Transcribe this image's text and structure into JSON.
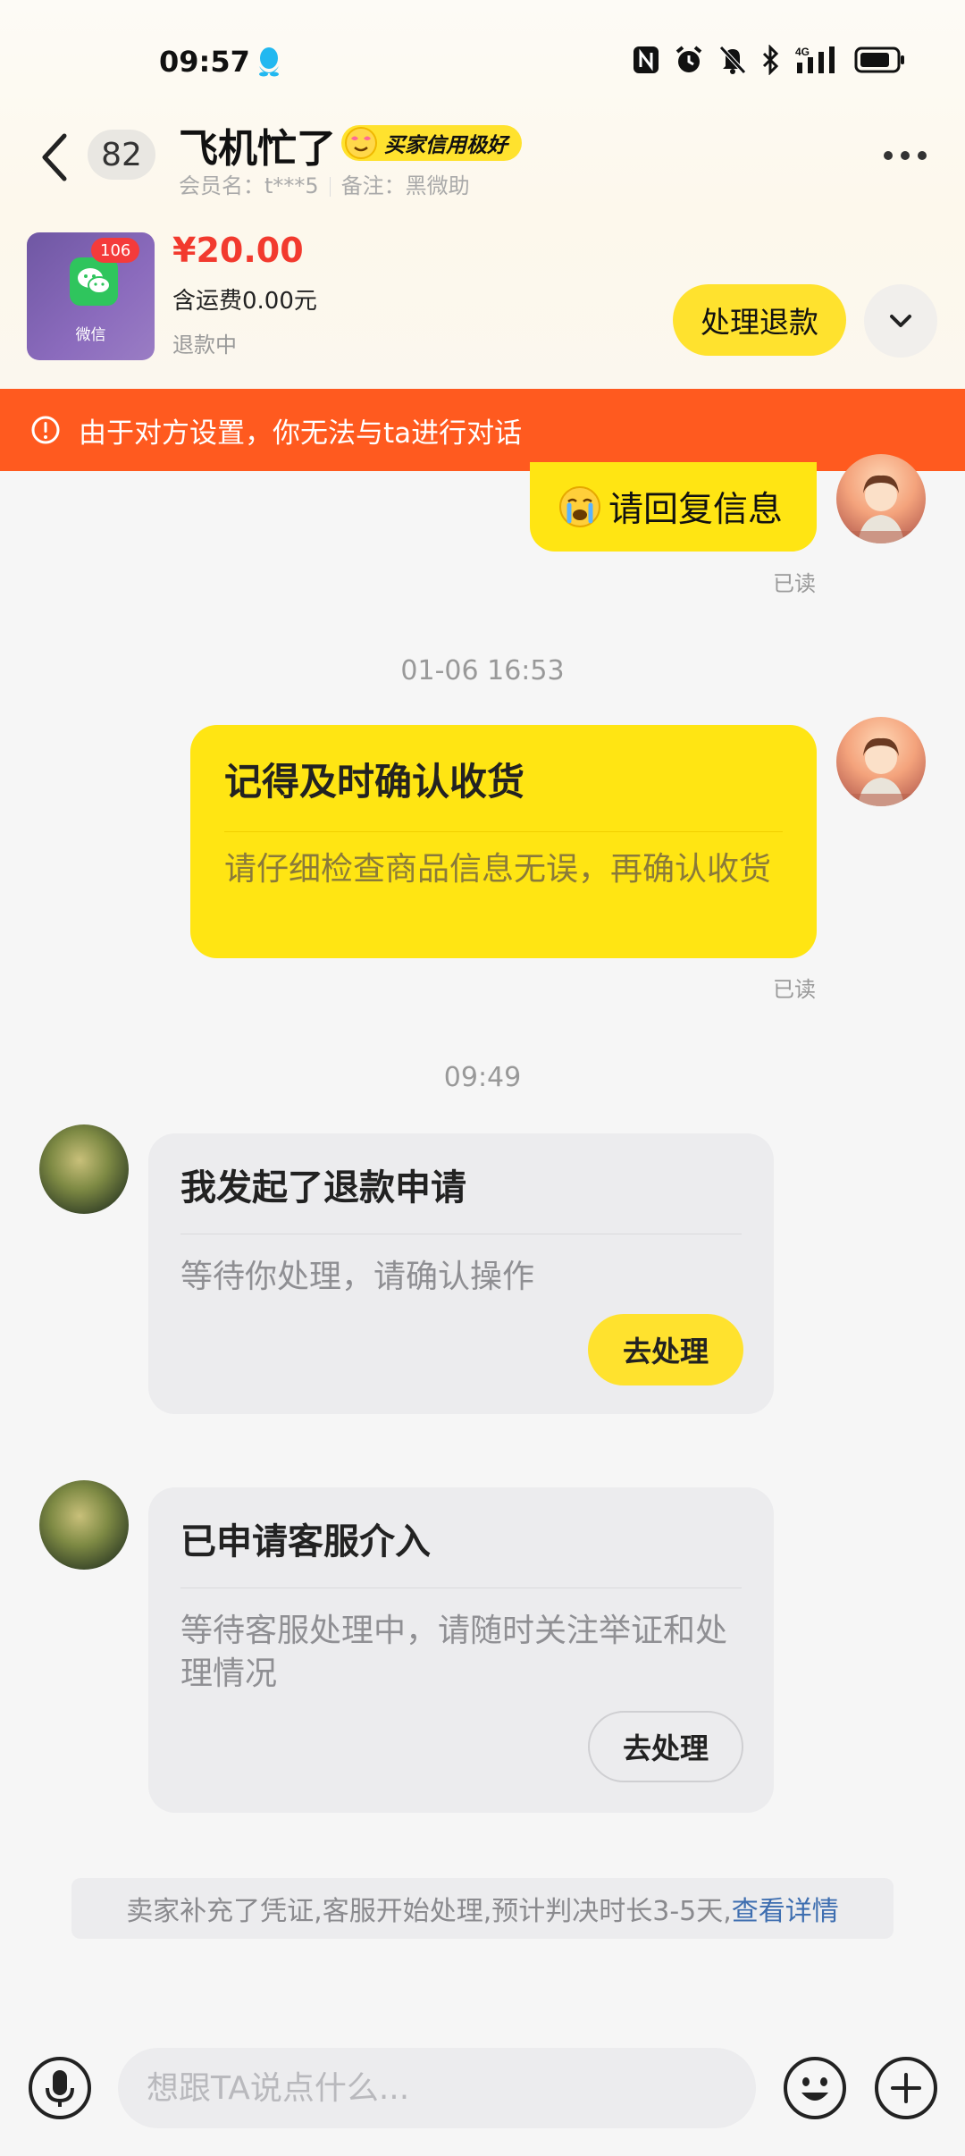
{
  "status_bar": {
    "time": "09:57",
    "network": "4G",
    "icons": [
      "qq-icon",
      "nfc-icon",
      "alarm-icon",
      "mute-icon",
      "bluetooth-icon",
      "signal-icon",
      "battery-icon"
    ]
  },
  "header": {
    "unread_count": "82",
    "title": "飞机忙了",
    "credit_badge": "买家信用极好",
    "member_label": "会员名：t***5",
    "note_label": "备注：黑微助"
  },
  "product": {
    "thumb_label": "微信",
    "thumb_badge": "106",
    "price": "¥20.00",
    "shipping": "含运费0.00元",
    "status": "退款中",
    "action_label": "处理退款"
  },
  "banner": {
    "text": "由于对方设置，你无法与ta进行对话",
    "color": "#ff5a1f"
  },
  "messages": {
    "m1": {
      "text": "请回复信息",
      "read": "已读"
    },
    "ts1": "01-06 16:53",
    "m2": {
      "title": "记得及时确认收货",
      "body": "请仔细检查商品信息无误，再确认收货",
      "read": "已读"
    },
    "ts2": "09:49",
    "m3": {
      "title": "我发起了退款申请",
      "body": "等待你处理，请确认操作",
      "button": "去处理"
    },
    "m4": {
      "title": "已申请客服介入",
      "body": "等待客服处理中，请随时关注举证和处理情况",
      "button": "去处理"
    }
  },
  "notice": {
    "text": "卖家补充了凭证,客服开始处理,预计判决时长3-5天,",
    "link": "查看详情"
  },
  "input": {
    "placeholder": "想跟TA说点什么..."
  },
  "colors": {
    "accent": "#ffe22e",
    "bubble": "#ffe513",
    "price": "#f23a2e",
    "link": "#3e6eb0"
  }
}
